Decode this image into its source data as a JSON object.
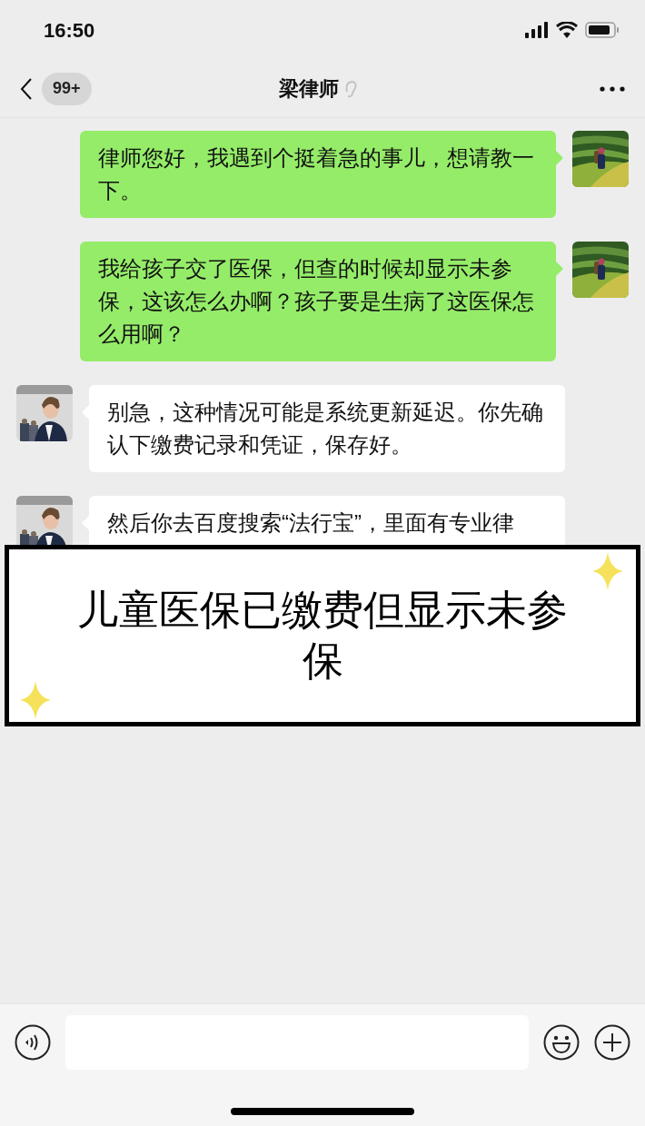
{
  "status_bar": {
    "time": "16:50"
  },
  "nav": {
    "unread_badge": "99+",
    "title": "梁律师"
  },
  "messages": [
    {
      "kind": "sent",
      "text": "律师您好，我遇到个挺着急的事儿，想请教一下。"
    },
    {
      "kind": "sent",
      "text": "我给孩子交了医保，但查的时候却显示未参保，这该怎么办啊？孩子要是生病了这医保怎么用啊？"
    },
    {
      "kind": "received",
      "text": "别急，这种情况可能是系统更新延迟。你先确认下缴费记录和凭证，保存好。"
    },
    {
      "kind": "received",
      "text": "然后你去百度搜索“法行宝”，里面有专业律"
    }
  ],
  "caption": "儿童医保已缴费但显示未参保"
}
